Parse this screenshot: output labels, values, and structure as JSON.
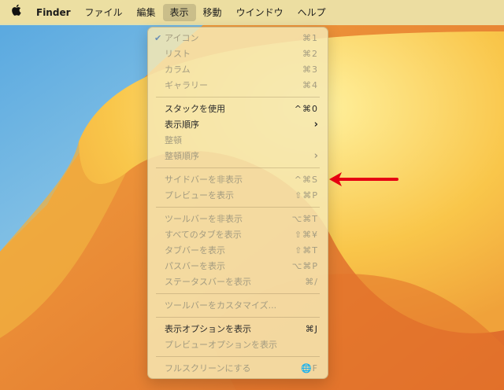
{
  "menubar": {
    "apple_icon": "apple-logo-icon",
    "items": [
      "Finder",
      "ファイル",
      "編集",
      "表示",
      "移動",
      "ウインドウ",
      "ヘルプ"
    ]
  },
  "menu": {
    "items": [
      {
        "label": "アイコン",
        "shortcut": "⌘1",
        "checked": true,
        "enabled": false
      },
      {
        "label": "リスト",
        "shortcut": "⌘2",
        "enabled": false
      },
      {
        "label": "カラム",
        "shortcut": "⌘3",
        "enabled": false
      },
      {
        "label": "ギャラリー",
        "shortcut": "⌘4",
        "enabled": false
      },
      {
        "label": "スタックを使用",
        "shortcut": "^⌘0",
        "enabled": true
      },
      {
        "label": "表示順序",
        "submenu": true,
        "enabled": true
      },
      {
        "label": "整頓",
        "enabled": false
      },
      {
        "label": "整頓順序",
        "submenu": true,
        "enabled": false
      },
      {
        "label": "サイドバーを非表示",
        "shortcut": "^⌘S",
        "enabled": false
      },
      {
        "label": "プレビューを表示",
        "shortcut": "⇧⌘P",
        "enabled": false
      },
      {
        "label": "ツールバーを非表示",
        "shortcut": "⌥⌘T",
        "enabled": false
      },
      {
        "label": "すべてのタブを表示",
        "shortcut": "⇧⌘¥",
        "enabled": false
      },
      {
        "label": "タブバーを表示",
        "shortcut": "⇧⌘T",
        "enabled": false
      },
      {
        "label": "パスバーを表示",
        "shortcut": "⌥⌘P",
        "enabled": false
      },
      {
        "label": "ステータスバーを表示",
        "shortcut": "⌘/",
        "enabled": false
      },
      {
        "label": "ツールバーをカスタマイズ...",
        "enabled": false
      },
      {
        "label": "表示オプションを表示",
        "shortcut": "⌘J",
        "enabled": true
      },
      {
        "label": "プレビューオプションを表示",
        "enabled": false
      },
      {
        "label": "フルスクリーンにする",
        "shortcut": "🌐F",
        "enabled": false
      }
    ]
  },
  "colors": {
    "annotation_arrow": "#e60012",
    "check": "#6a8fb5"
  }
}
